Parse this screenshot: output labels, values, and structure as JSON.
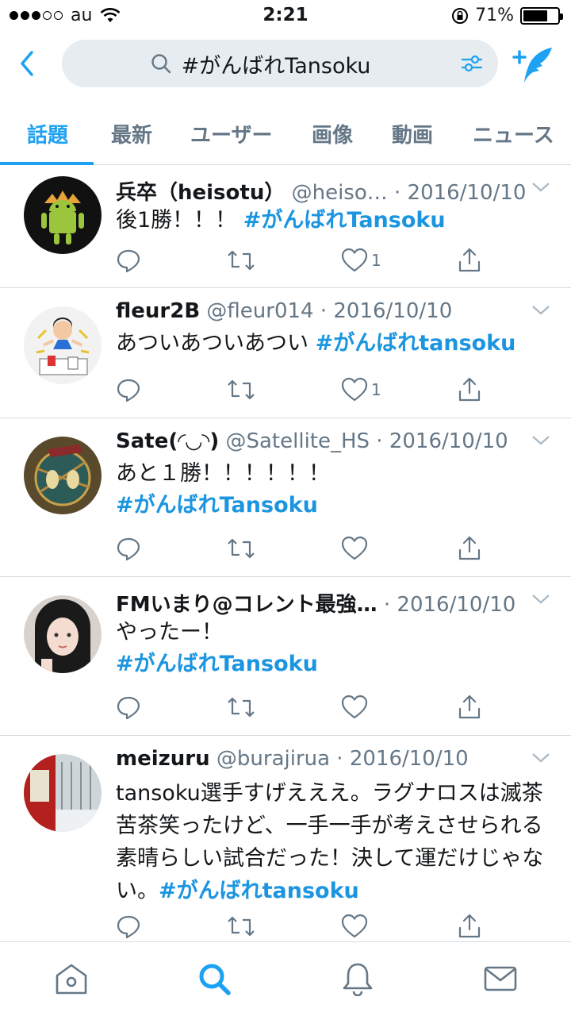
{
  "status_bar": {
    "carrier": "au",
    "time": "2:21",
    "battery": "71%",
    "battery_level": 0.71
  },
  "search": {
    "query": "#がんばれTansoku"
  },
  "tabs": [
    {
      "label": "話題",
      "active": true
    },
    {
      "label": "最新",
      "active": false
    },
    {
      "label": "ユーザー",
      "active": false
    },
    {
      "label": "画像",
      "active": false
    },
    {
      "label": "動画",
      "active": false
    },
    {
      "label": "ニュース",
      "active": false
    }
  ],
  "tweets": [
    {
      "name": "兵卒（heisotu）",
      "meta": "@heiso… · 2016/10/10",
      "text": "後1勝！！！",
      "hashtag": "#がんばれTansoku",
      "likes": "1"
    },
    {
      "name": "fleur2B",
      "meta": "@fleur014 · 2016/10/10",
      "text": "あついあついあつい",
      "hashtag": "#がんばれtansoku",
      "likes": "1"
    },
    {
      "name": "Sate(◜◡◝)",
      "meta": "@Satellite_HS · 2016/10/10",
      "text": "あと１勝！！！！！！",
      "hashtag": "#がんばれTansoku",
      "likes": ""
    },
    {
      "name": "FMいまり@コレント最強…",
      "meta": "· 2016/10/10",
      "text": "やったー！",
      "hashtag": "#がんばれTansoku",
      "likes": ""
    },
    {
      "name": "meizuru",
      "meta": "@burajirua · 2016/10/10",
      "text": "tansoku選手すげえええ。ラグナロスは滅茶苦茶笑ったけど、一手一手が考えさせられる素晴らしい試合だった！決して運だけじゃない。",
      "hashtag": "#がんばれtansoku",
      "likes": ""
    }
  ],
  "colors": {
    "accent": "#1da1f2",
    "hashtag": "#1b95e0",
    "muted": "#657786",
    "divider": "#d5dbe0"
  },
  "icons": {
    "back": "chevron-left-icon",
    "search": "search-icon",
    "filter": "filter-icon",
    "compose": "compose-tweet-icon",
    "reply": "reply-icon",
    "retweet": "retweet-icon",
    "like": "heart-icon",
    "share": "share-icon",
    "nav": [
      "home-icon",
      "search-icon",
      "notifications-icon",
      "messages-icon"
    ]
  }
}
